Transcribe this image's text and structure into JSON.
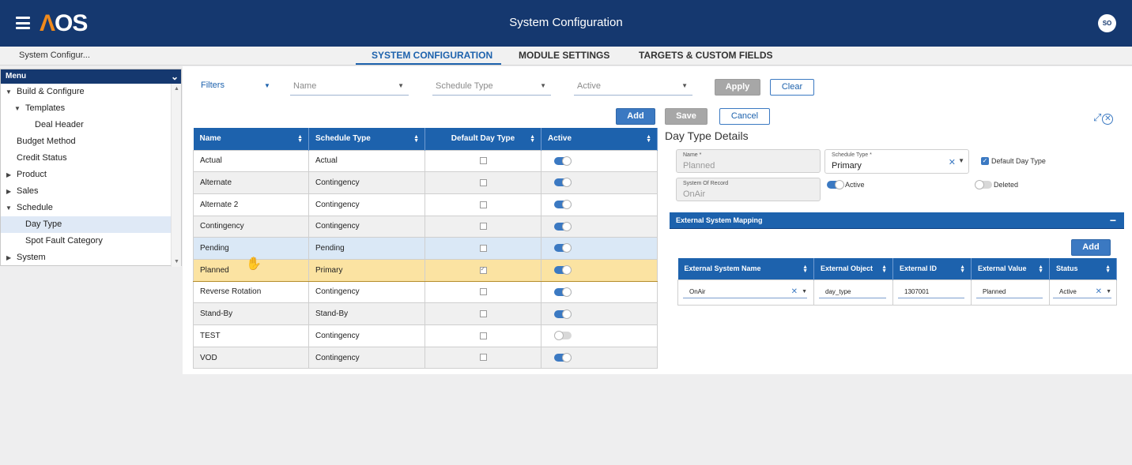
{
  "header": {
    "logo": "AOS",
    "title": "System Configuration",
    "avatar_initials": "SO"
  },
  "tabs": {
    "breadcrumb": "System Configur...",
    "items": [
      {
        "label": "SYSTEM CONFIGURATION",
        "active": true
      },
      {
        "label": "MODULE SETTINGS",
        "active": false
      },
      {
        "label": "TARGETS & CUSTOM FIELDS",
        "active": false
      }
    ]
  },
  "sidebar": {
    "title": "Menu",
    "items": [
      {
        "label": "Build & Configure",
        "level": 0,
        "expanded": true
      },
      {
        "label": "Templates",
        "level": 1,
        "expanded": true
      },
      {
        "label": "Deal Header",
        "level": 2
      },
      {
        "label": "Budget Method",
        "level": 0
      },
      {
        "label": "Credit Status",
        "level": 0
      },
      {
        "label": "Product",
        "level": 0,
        "expanded": false
      },
      {
        "label": "Sales",
        "level": 0,
        "expanded": false
      },
      {
        "label": "Schedule",
        "level": 0,
        "expanded": true
      },
      {
        "label": "Day Type",
        "level": 1,
        "selected": true
      },
      {
        "label": "Spot Fault Category",
        "level": 1
      },
      {
        "label": "System",
        "level": 0,
        "expanded": false
      }
    ]
  },
  "filters": {
    "label": "Filters",
    "name_placeholder": "Name",
    "schedule_type_placeholder": "Schedule Type",
    "active_placeholder": "Active",
    "apply_label": "Apply",
    "clear_label": "Clear"
  },
  "actions": {
    "add_label": "Add",
    "save_label": "Save",
    "cancel_label": "Cancel"
  },
  "grid": {
    "columns": [
      "Name",
      "Schedule Type",
      "Default Day Type",
      "Active"
    ],
    "rows": [
      {
        "name": "Actual",
        "schedule_type": "Actual",
        "default": false,
        "active": true
      },
      {
        "name": "Alternate",
        "schedule_type": "Contingency",
        "default": false,
        "active": true
      },
      {
        "name": "Alternate 2",
        "schedule_type": "Contingency",
        "default": false,
        "active": true
      },
      {
        "name": "Contingency",
        "schedule_type": "Contingency",
        "default": false,
        "active": true
      },
      {
        "name": "Pending",
        "schedule_type": "Pending",
        "default": false,
        "active": true
      },
      {
        "name": "Planned",
        "schedule_type": "Primary",
        "default": true,
        "active": true
      },
      {
        "name": "Reverse Rotation",
        "schedule_type": "Contingency",
        "default": false,
        "active": true
      },
      {
        "name": "Stand-By",
        "schedule_type": "Stand-By",
        "default": false,
        "active": true
      },
      {
        "name": "TEST",
        "schedule_type": "Contingency",
        "default": false,
        "active": false
      },
      {
        "name": "VOD",
        "schedule_type": "Contingency",
        "default": false,
        "active": true
      }
    ]
  },
  "details": {
    "title": "Day Type Details",
    "name_label": "Name *",
    "name_value": "Planned",
    "schedule_type_label": "Schedule Type *",
    "schedule_type_value": "Primary",
    "default_day_type_label": "Default Day Type",
    "system_of_record_label": "System Of Record",
    "system_of_record_value": "OnAir",
    "active_label": "Active",
    "deleted_label": "Deleted"
  },
  "mapping": {
    "title": "External System Mapping",
    "add_label": "Add",
    "columns": [
      "External System Name",
      "External Object",
      "External ID",
      "External Value",
      "Status"
    ],
    "row": {
      "system_name": "OnAir",
      "object": "day_type",
      "id": "1307001",
      "value": "Planned",
      "status": "Active"
    }
  },
  "colors": {
    "header_bg": "#15386f",
    "accent": "#1d62ad",
    "logo_accent": "#f08a1c",
    "selected_row": "#fbe3a2"
  }
}
